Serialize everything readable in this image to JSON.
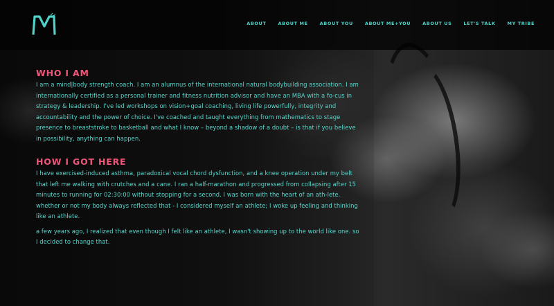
{
  "header": {
    "logo_alt": "M",
    "nav": [
      "ABOUT",
      "ABOUT ME",
      "ABOUT YOU",
      "ABOUT ME+YOU",
      "ABOUT US",
      "LET'S TALK",
      "MY TRIBE"
    ]
  },
  "sections": [
    {
      "title": "WHO I AM",
      "paragraphs": [
        "I am a mind|body strength coach. I am an alumnus of the international natural bodybuilding association. I am internationally certified as a personal trainer and fitness nutrition advisor and have an MBA with a fo-cus in strategy & leadership.  I've led workshops on vision+goal coaching, living life powerfully, integrity and accountability and the power of choice. I've coached and taught everything from mathematics to stage presence to breaststroke to basketball and what I know – beyond a shadow of a doubt – is that if you believe in possibility, anything can happen."
      ]
    },
    {
      "title": "HOW I GOT HERE",
      "paragraphs": [
        "I have exercised-induced asthma, paradoxical vocal chord dysfunction, and a knee operation under my belt that left me walking with crutches and a cane. I ran a half-marathon and progressed from collapsing after 15 minutes to running for 02:30:00 without stopping for a second. I was born with the heart of an ath-lete. whether or not my body always reflected that - I considered myself an athlete; I woke up feeling and thinking like an athlete.",
        "a few years ago, I realized that even though I felt like an athlete, I wasn't showing up to the world like one. so I decided to change that."
      ]
    }
  ],
  "colors": {
    "accent_teal": "#4fd3c9",
    "heading_pink": "#f0567a"
  }
}
